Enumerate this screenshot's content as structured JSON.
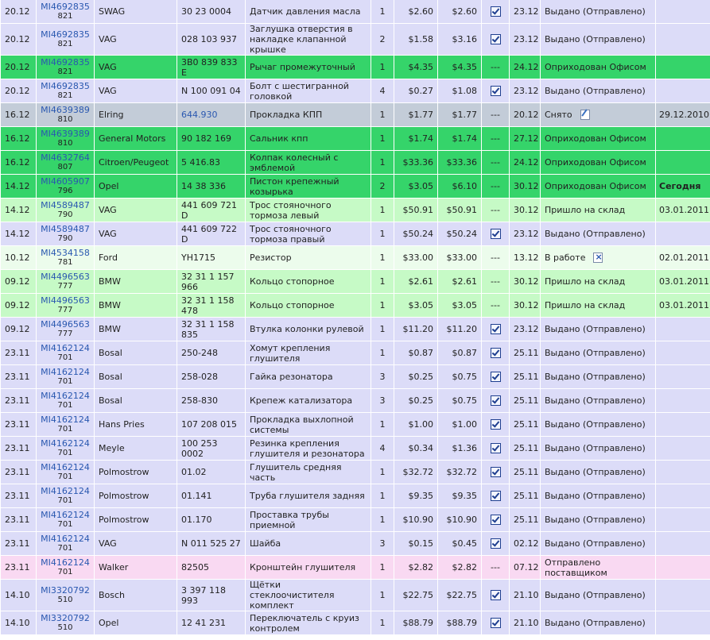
{
  "rows": [
    {
      "date": "20.12",
      "order": "MI4692835",
      "order_sub": "821",
      "brand": "SWAG",
      "article": "30 23 0004",
      "name": "Датчик давления масла",
      "qty": "1",
      "price": "$2.60",
      "sum": "$2.60",
      "mark": "check",
      "date2": "23.12",
      "status": "Выдано (Отправлено)",
      "status_icon": "",
      "extra": "",
      "extra_bold": false,
      "tone": "issued",
      "article_link": false
    },
    {
      "date": "20.12",
      "order": "MI4692835",
      "order_sub": "821",
      "brand": "VAG",
      "article": "028 103 937",
      "name": "Заглушка отверстия в накладке клапанной крышке",
      "qty": "2",
      "price": "$1.58",
      "sum": "$3.16",
      "mark": "check",
      "date2": "23.12",
      "status": "Выдано (Отправлено)",
      "status_icon": "",
      "extra": "",
      "extra_bold": false,
      "tone": "issued",
      "article_link": false
    },
    {
      "date": "20.12",
      "order": "MI4692835",
      "order_sub": "821",
      "brand": "VAG",
      "article": "3B0 839 833 E",
      "name": "Рычаг промежуточный",
      "qty": "1",
      "price": "$4.35",
      "sum": "$4.35",
      "mark": "---",
      "date2": "24.12",
      "status": "Оприходован Офисом",
      "status_icon": "",
      "extra": "",
      "extra_bold": false,
      "tone": "office",
      "article_link": false
    },
    {
      "date": "20.12",
      "order": "MI4692835",
      "order_sub": "821",
      "brand": "VAG",
      "article": "N 100 091 04",
      "name": "Болт с шестигранной головкой",
      "qty": "4",
      "price": "$0.27",
      "sum": "$1.08",
      "mark": "check",
      "date2": "23.12",
      "status": "Выдано (Отправлено)",
      "status_icon": "",
      "extra": "",
      "extra_bold": false,
      "tone": "issued",
      "article_link": false
    },
    {
      "date": "16.12",
      "order": "MI4639389",
      "order_sub": "810",
      "brand": "Elring",
      "article": "644.930",
      "name": "Прокладка КПП",
      "qty": "1",
      "price": "$1.77",
      "sum": "$1.77",
      "mark": "---",
      "date2": "20.12",
      "status": "Снято",
      "status_icon": "edit",
      "extra": "29.12.2010",
      "extra_bold": false,
      "tone": "removed",
      "article_link": true
    },
    {
      "date": "16.12",
      "order": "MI4639389",
      "order_sub": "810",
      "brand": "General Motors",
      "article": "90 182 169",
      "name": "Сальник кпп",
      "qty": "1",
      "price": "$1.74",
      "sum": "$1.74",
      "mark": "---",
      "date2": "27.12",
      "status": "Оприходован Офисом",
      "status_icon": "",
      "extra": "",
      "extra_bold": false,
      "tone": "office",
      "article_link": false
    },
    {
      "date": "16.12",
      "order": "MI4632764",
      "order_sub": "807",
      "brand": "Citroen/Peugeot",
      "article": "5 416.83",
      "name": "Колпак колесный с эмблемой",
      "qty": "1",
      "price": "$33.36",
      "sum": "$33.36",
      "mark": "---",
      "date2": "24.12",
      "status": "Оприходован Офисом",
      "status_icon": "",
      "extra": "",
      "extra_bold": false,
      "tone": "office",
      "article_link": false
    },
    {
      "date": "14.12",
      "order": "MI4605907",
      "order_sub": "796",
      "brand": "Opel",
      "article": "14 38 336",
      "name": "Пистон крепежный козырька",
      "qty": "2",
      "price": "$3.05",
      "sum": "$6.10",
      "mark": "---",
      "date2": "30.12",
      "status": "Оприходован Офисом",
      "status_icon": "",
      "extra": "Сегодня",
      "extra_bold": true,
      "tone": "office",
      "article_link": false
    },
    {
      "date": "14.12",
      "order": "MI4589487",
      "order_sub": "790",
      "brand": "VAG",
      "article": "441 609 721 D",
      "name": "Трос стояночного тормоза левый",
      "qty": "1",
      "price": "$50.91",
      "sum": "$50.91",
      "mark": "---",
      "date2": "30.12",
      "status": "Пришло на склад",
      "status_icon": "",
      "extra": "03.01.2011",
      "extra_bold": false,
      "tone": "warehouse",
      "article_link": false
    },
    {
      "date": "14.12",
      "order": "MI4589487",
      "order_sub": "790",
      "brand": "VAG",
      "article": "441 609 722 D",
      "name": "Трос стояночного тормоза правый",
      "qty": "1",
      "price": "$50.24",
      "sum": "$50.24",
      "mark": "check",
      "date2": "23.12",
      "status": "Выдано (Отправлено)",
      "status_icon": "",
      "extra": "",
      "extra_bold": false,
      "tone": "issued",
      "article_link": false
    },
    {
      "date": "10.12",
      "order": "MI4534158",
      "order_sub": "781",
      "brand": "Ford",
      "article": "YH1715",
      "name": "Резистор",
      "qty": "1",
      "price": "$33.00",
      "sum": "$33.00",
      "mark": "---",
      "date2": "13.12",
      "status": "В работе",
      "status_icon": "cancel",
      "extra": "02.01.2011",
      "extra_bold": false,
      "tone": "work",
      "article_link": false
    },
    {
      "date": "09.12",
      "order": "MI4496563",
      "order_sub": "777",
      "brand": "BMW",
      "article": "32 31 1 157 966",
      "name": "Кольцо стопорное",
      "qty": "1",
      "price": "$2.61",
      "sum": "$2.61",
      "mark": "---",
      "date2": "30.12",
      "status": "Пришло на склад",
      "status_icon": "",
      "extra": "03.01.2011",
      "extra_bold": false,
      "tone": "warehouse",
      "article_link": false
    },
    {
      "date": "09.12",
      "order": "MI4496563",
      "order_sub": "777",
      "brand": "BMW",
      "article": "32 31 1 158 478",
      "name": "Кольцо стопорное",
      "qty": "1",
      "price": "$3.05",
      "sum": "$3.05",
      "mark": "---",
      "date2": "30.12",
      "status": "Пришло на склад",
      "status_icon": "",
      "extra": "03.01.2011",
      "extra_bold": false,
      "tone": "warehouse",
      "article_link": false
    },
    {
      "date": "09.12",
      "order": "MI4496563",
      "order_sub": "777",
      "brand": "BMW",
      "article": "32 31 1 158 835",
      "name": "Втулка колонки рулевой",
      "qty": "1",
      "price": "$11.20",
      "sum": "$11.20",
      "mark": "check",
      "date2": "23.12",
      "status": "Выдано (Отправлено)",
      "status_icon": "",
      "extra": "",
      "extra_bold": false,
      "tone": "issued",
      "article_link": false
    },
    {
      "date": "23.11",
      "order": "MI4162124",
      "order_sub": "701",
      "brand": "Bosal",
      "article": "250-248",
      "name": "Хомут крепления глушителя",
      "qty": "1",
      "price": "$0.87",
      "sum": "$0.87",
      "mark": "check",
      "date2": "25.11",
      "status": "Выдано (Отправлено)",
      "status_icon": "",
      "extra": "",
      "extra_bold": false,
      "tone": "issued",
      "article_link": false
    },
    {
      "date": "23.11",
      "order": "MI4162124",
      "order_sub": "701",
      "brand": "Bosal",
      "article": "258-028",
      "name": "Гайка резонатора",
      "qty": "3",
      "price": "$0.25",
      "sum": "$0.75",
      "mark": "check",
      "date2": "25.11",
      "status": "Выдано (Отправлено)",
      "status_icon": "",
      "extra": "",
      "extra_bold": false,
      "tone": "issued",
      "article_link": false
    },
    {
      "date": "23.11",
      "order": "MI4162124",
      "order_sub": "701",
      "brand": "Bosal",
      "article": "258-830",
      "name": "Крепеж катализатора",
      "qty": "3",
      "price": "$0.25",
      "sum": "$0.75",
      "mark": "check",
      "date2": "25.11",
      "status": "Выдано (Отправлено)",
      "status_icon": "",
      "extra": "",
      "extra_bold": false,
      "tone": "issued",
      "article_link": false
    },
    {
      "date": "23.11",
      "order": "MI4162124",
      "order_sub": "701",
      "brand": "Hans Pries",
      "article": "107 208 015",
      "name": "Прокладка выхлопной системы",
      "qty": "1",
      "price": "$1.00",
      "sum": "$1.00",
      "mark": "check",
      "date2": "25.11",
      "status": "Выдано (Отправлено)",
      "status_icon": "",
      "extra": "",
      "extra_bold": false,
      "tone": "issued",
      "article_link": false
    },
    {
      "date": "23.11",
      "order": "MI4162124",
      "order_sub": "701",
      "brand": "Meyle",
      "article": "100 253 0002",
      "name": "Резинка крепления глушителя и резонатора",
      "qty": "4",
      "price": "$0.34",
      "sum": "$1.36",
      "mark": "check",
      "date2": "25.11",
      "status": "Выдано (Отправлено)",
      "status_icon": "",
      "extra": "",
      "extra_bold": false,
      "tone": "issued",
      "article_link": false
    },
    {
      "date": "23.11",
      "order": "MI4162124",
      "order_sub": "701",
      "brand": "Polmostrow",
      "article": "01.02",
      "name": "Глушитель средняя часть",
      "qty": "1",
      "price": "$32.72",
      "sum": "$32.72",
      "mark": "check",
      "date2": "25.11",
      "status": "Выдано (Отправлено)",
      "status_icon": "",
      "extra": "",
      "extra_bold": false,
      "tone": "issued",
      "article_link": false
    },
    {
      "date": "23.11",
      "order": "MI4162124",
      "order_sub": "701",
      "brand": "Polmostrow",
      "article": "01.141",
      "name": "Труба глушителя задняя",
      "qty": "1",
      "price": "$9.35",
      "sum": "$9.35",
      "mark": "check",
      "date2": "25.11",
      "status": "Выдано (Отправлено)",
      "status_icon": "",
      "extra": "",
      "extra_bold": false,
      "tone": "issued",
      "article_link": false
    },
    {
      "date": "23.11",
      "order": "MI4162124",
      "order_sub": "701",
      "brand": "Polmostrow",
      "article": "01.170",
      "name": "Проставка трубы приемной",
      "qty": "1",
      "price": "$10.90",
      "sum": "$10.90",
      "mark": "check",
      "date2": "25.11",
      "status": "Выдано (Отправлено)",
      "status_icon": "",
      "extra": "",
      "extra_bold": false,
      "tone": "issued",
      "article_link": false
    },
    {
      "date": "23.11",
      "order": "MI4162124",
      "order_sub": "701",
      "brand": "VAG",
      "article": "N 011 525 27",
      "name": "Шайба",
      "qty": "3",
      "price": "$0.15",
      "sum": "$0.45",
      "mark": "check",
      "date2": "02.12",
      "status": "Выдано (Отправлено)",
      "status_icon": "",
      "extra": "",
      "extra_bold": false,
      "tone": "issued",
      "article_link": false
    },
    {
      "date": "23.11",
      "order": "MI4162124",
      "order_sub": "701",
      "brand": "Walker",
      "article": "82505",
      "name": "Кронштейн глушителя",
      "qty": "1",
      "price": "$2.82",
      "sum": "$2.82",
      "mark": "---",
      "date2": "07.12",
      "status": "Отправлено поставщиком",
      "status_icon": "",
      "extra": "",
      "extra_bold": false,
      "tone": "supplier",
      "article_link": false
    },
    {
      "date": "14.10",
      "order": "MI3320792",
      "order_sub": "510",
      "brand": "Bosch",
      "article": "3 397 118 993",
      "name": "Щётки стеклоочистителя комплект",
      "qty": "1",
      "price": "$22.75",
      "sum": "$22.75",
      "mark": "check",
      "date2": "21.10",
      "status": "Выдано (Отправлено)",
      "status_icon": "",
      "extra": "",
      "extra_bold": false,
      "tone": "issued",
      "article_link": false
    },
    {
      "date": "14.10",
      "order": "MI3320792",
      "order_sub": "510",
      "brand": "Opel",
      "article": "12 41 231",
      "name": "Переключатель с круиз контролем",
      "qty": "1",
      "price": "$88.79",
      "sum": "$88.79",
      "mark": "check",
      "date2": "21.10",
      "status": "Выдано (Отправлено)",
      "status_icon": "",
      "extra": "",
      "extra_bold": false,
      "tone": "issued",
      "article_link": false
    }
  ],
  "icons": {
    "check": "checkbox-checked-icon",
    "edit": "edit-note-icon",
    "cancel": "cancel-document-icon"
  }
}
